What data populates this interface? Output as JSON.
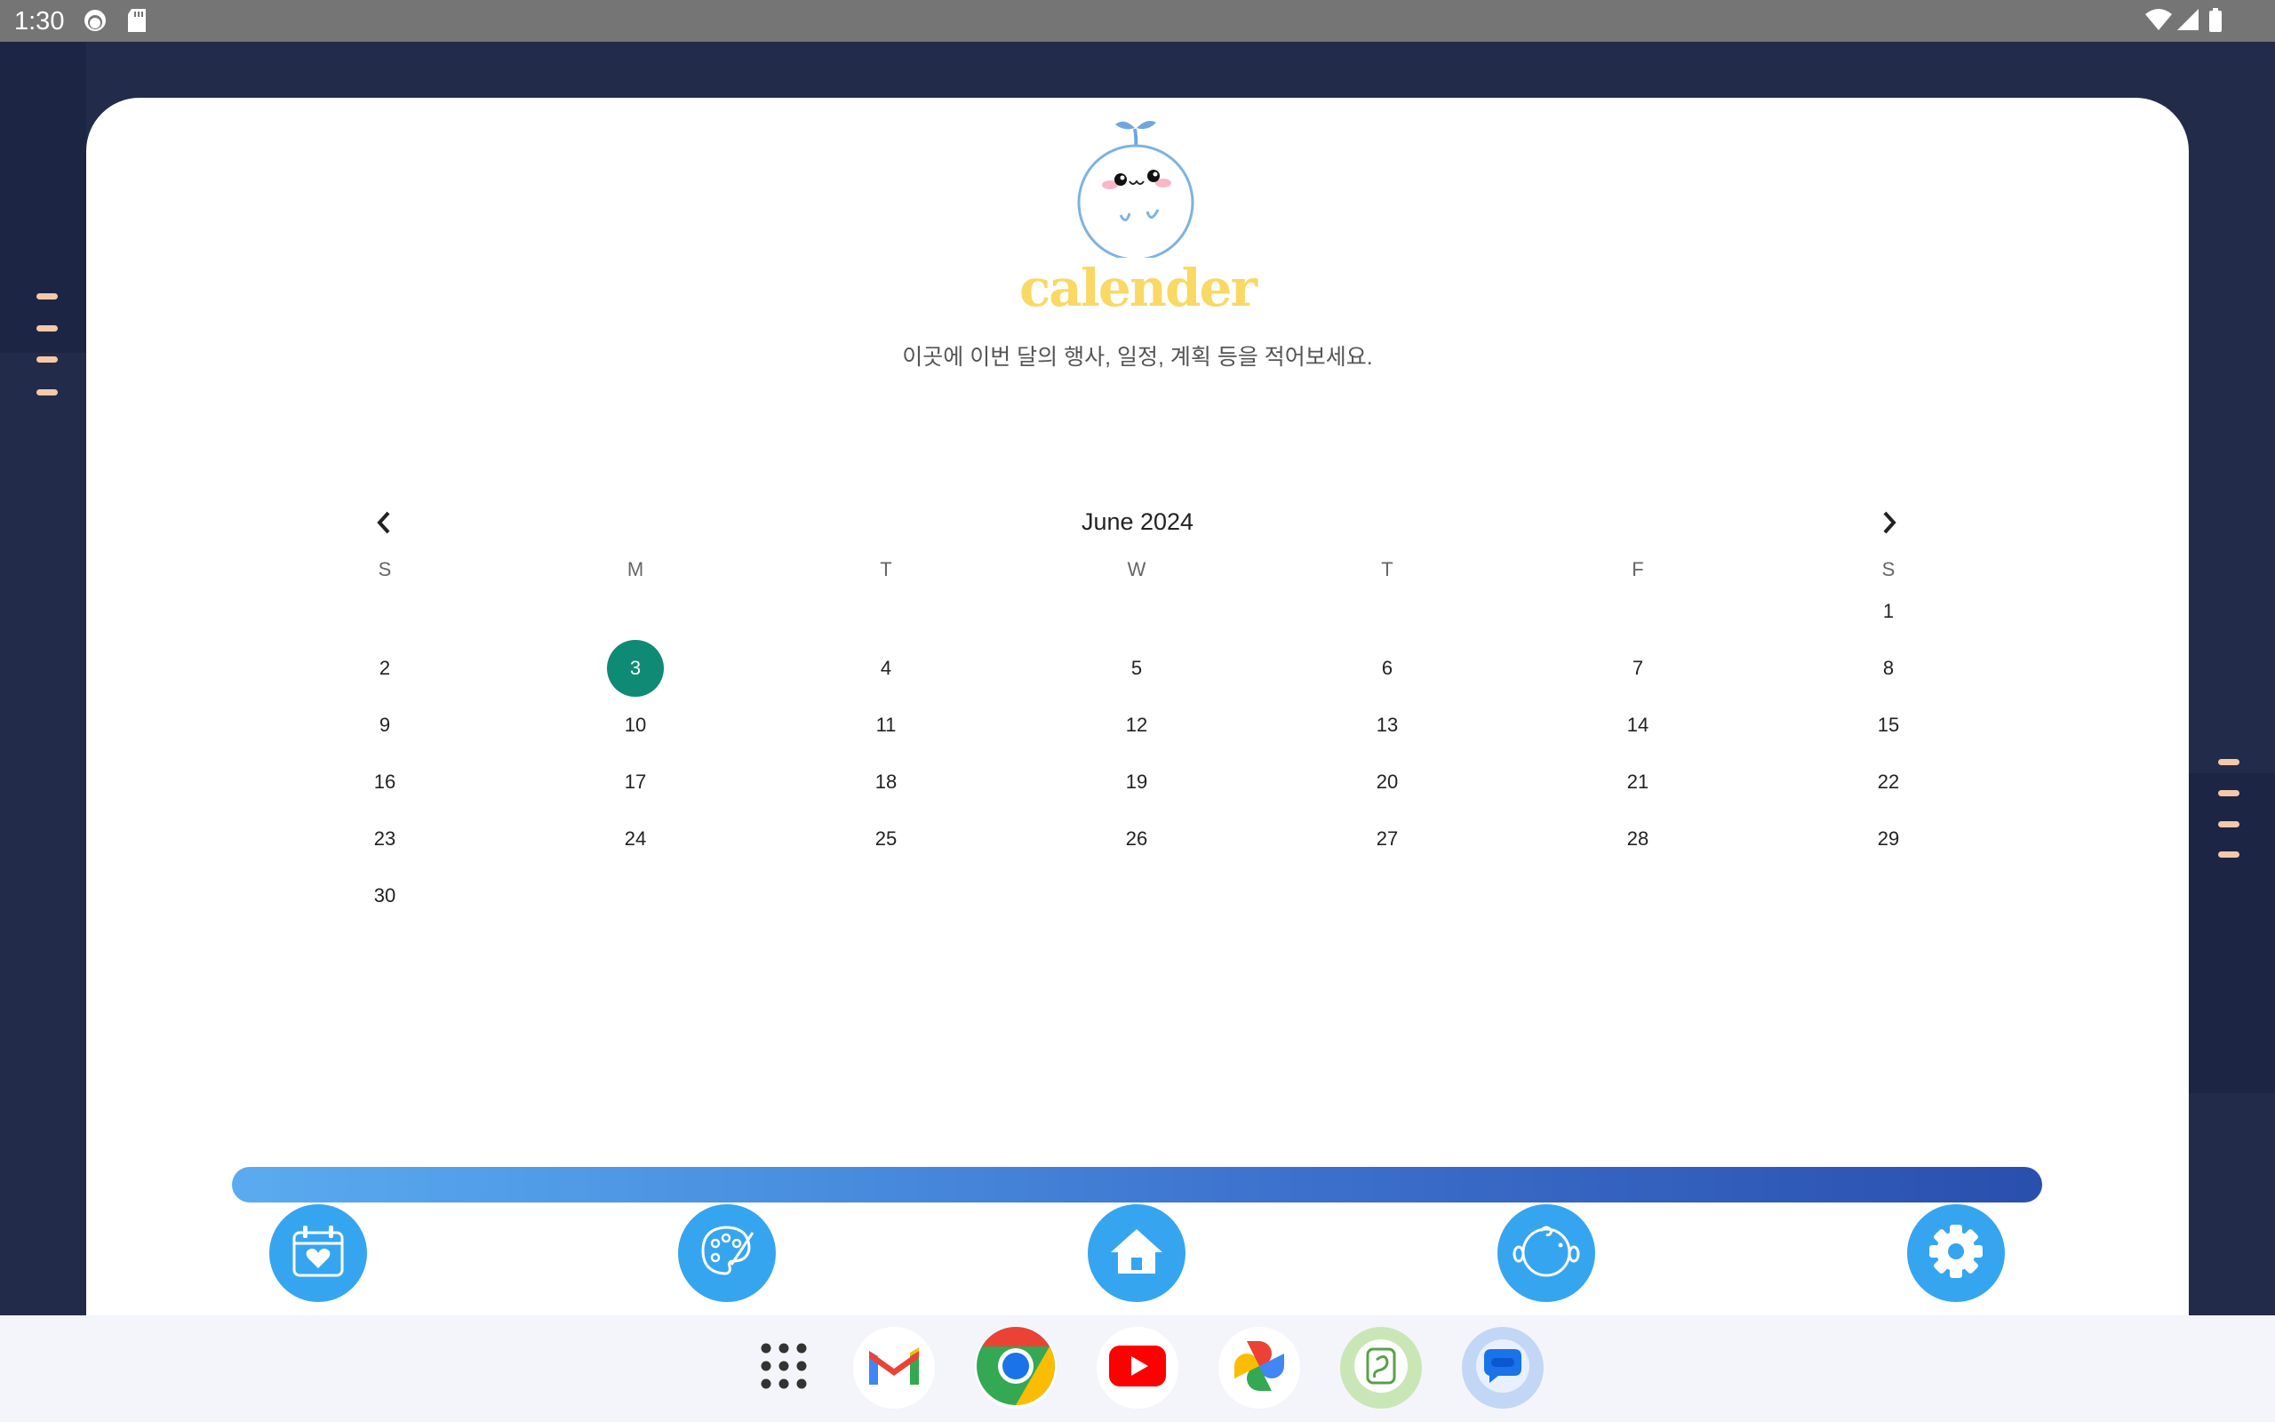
{
  "status_bar": {
    "time": "1:30",
    "left_icons": [
      "face-notification-icon",
      "sd-card-icon"
    ],
    "right_icons": [
      "wifi-icon",
      "signal-icon",
      "battery-icon"
    ]
  },
  "header": {
    "title": "calender",
    "subtitle": "이곳에 이번 달의 행사, 일정, 계획 등을 적어보세요.",
    "mascot_icon": "sprout-mascot-icon"
  },
  "calendar": {
    "month_label": "June 2024",
    "prev_icon": "chevron-left-icon",
    "next_icon": "chevron-right-icon",
    "weekdays": [
      "S",
      "M",
      "T",
      "W",
      "T",
      "F",
      "S"
    ],
    "weeks": [
      [
        "",
        "",
        "",
        "",
        "",
        "",
        "1"
      ],
      [
        "2",
        "3",
        "4",
        "5",
        "6",
        "7",
        "8"
      ],
      [
        "9",
        "10",
        "11",
        "12",
        "13",
        "14",
        "15"
      ],
      [
        "16",
        "17",
        "18",
        "19",
        "20",
        "21",
        "22"
      ],
      [
        "23",
        "24",
        "25",
        "26",
        "27",
        "28",
        "29"
      ],
      [
        "30",
        "",
        "",
        "",
        "",
        "",
        ""
      ]
    ],
    "selected_day": "3",
    "selected_color": "#0f8a75"
  },
  "bottom_nav": {
    "items": [
      {
        "icon": "calendar-heart-icon"
      },
      {
        "icon": "palette-icon"
      },
      {
        "icon": "home-icon"
      },
      {
        "icon": "baby-face-icon"
      },
      {
        "icon": "gear-icon"
      }
    ],
    "accent": "#36a5f0"
  },
  "dock": {
    "apps": [
      {
        "icon": "app-drawer-icon"
      },
      {
        "icon": "gmail-icon"
      },
      {
        "icon": "chrome-icon"
      },
      {
        "icon": "youtube-icon"
      },
      {
        "icon": "photos-icon"
      },
      {
        "icon": "diary-app-icon"
      },
      {
        "icon": "messages-icon"
      }
    ]
  }
}
